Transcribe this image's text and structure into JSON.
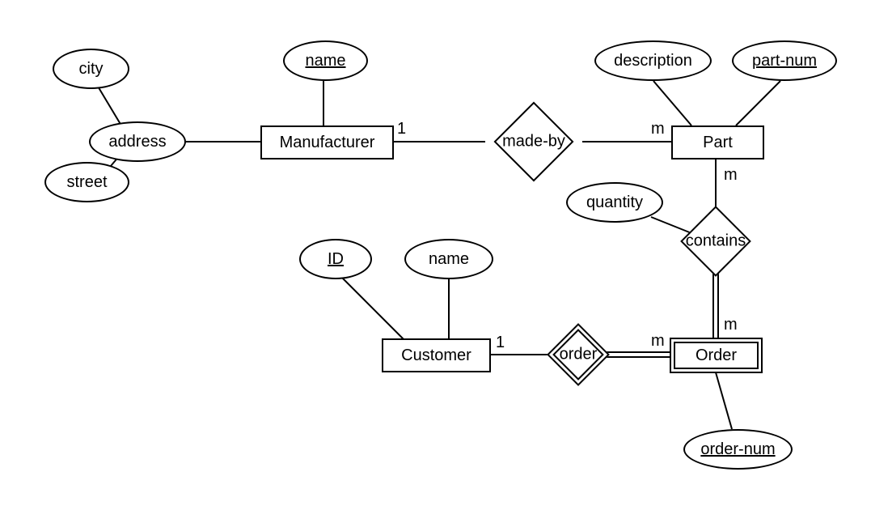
{
  "entities": {
    "manufacturer": {
      "label": "Manufacturer"
    },
    "part": {
      "label": "Part"
    },
    "customer": {
      "label": "Customer"
    },
    "order": {
      "label": "Order",
      "weak": true
    }
  },
  "relationships": {
    "made_by": {
      "label": "made-by",
      "identifying": false
    },
    "contains": {
      "label": "contains",
      "identifying": false
    },
    "order": {
      "label": "order",
      "identifying": true
    }
  },
  "attributes": {
    "city": {
      "label": "city",
      "of": "address",
      "key": false
    },
    "street": {
      "label": "street",
      "of": "address",
      "key": false
    },
    "address": {
      "label": "address",
      "of": "manufacturer",
      "key": false,
      "composite": true
    },
    "mfr_name": {
      "label": "name",
      "of": "manufacturer",
      "key": true
    },
    "description": {
      "label": "description",
      "of": "part",
      "key": false
    },
    "part_num": {
      "label": "part-num",
      "of": "part",
      "key": true
    },
    "quantity": {
      "label": "quantity",
      "of": "contains",
      "key": false
    },
    "cust_id": {
      "label": "ID",
      "of": "customer",
      "key": true
    },
    "cust_name": {
      "label": "name",
      "of": "customer",
      "key": false
    },
    "order_num": {
      "label": "order-num",
      "of": "order",
      "key": true,
      "discriminator": true
    }
  },
  "cardinalities": {
    "made_by_manufacturer": "1",
    "made_by_part": "m",
    "contains_part": "m",
    "contains_order": "m",
    "order_customer": "1",
    "order_order": "m"
  }
}
